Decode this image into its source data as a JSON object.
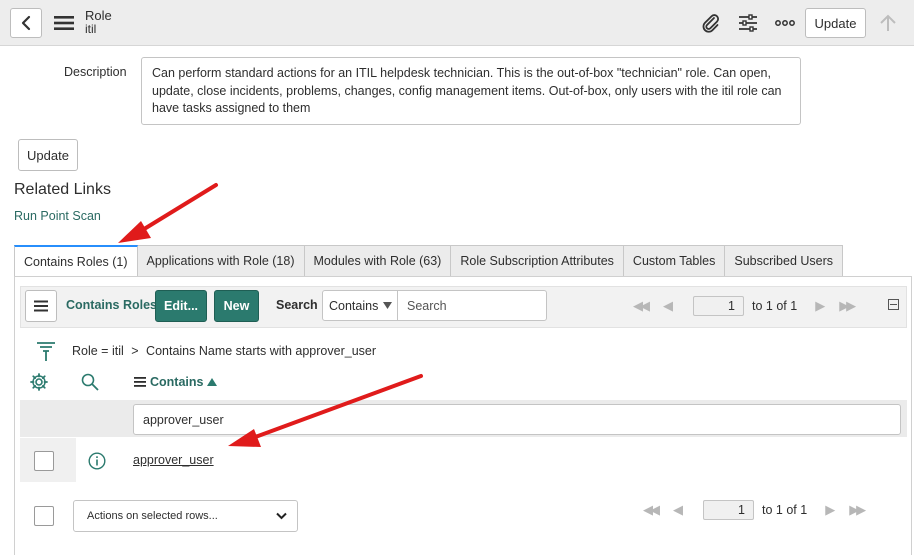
{
  "header": {
    "record_type": "Role",
    "record_name": "itil",
    "update_label": "Update",
    "icons": [
      "chevron-left-icon",
      "hamburger-icon",
      "paperclip-icon",
      "sliders-icon",
      "more-icon",
      "arrow-up-icon"
    ]
  },
  "form": {
    "description_label": "Description",
    "description": "Can perform standard actions for an ITIL helpdesk technician. This is the out-of-box \"technician\" role. Can open, update, close incidents, problems, changes, config management items. Out-of-box, only users with the itil role can have tasks assigned to them",
    "update_label": "Update"
  },
  "related_links": {
    "title": "Related Links",
    "run_point_scan": "Run Point Scan"
  },
  "tabs": [
    {
      "label": "Contains Roles (1)",
      "active": true
    },
    {
      "label": "Applications with Role (18)"
    },
    {
      "label": "Modules with Role (63)"
    },
    {
      "label": "Role Subscription Attributes"
    },
    {
      "label": "Custom Tables"
    },
    {
      "label": "Subscribed Users"
    }
  ],
  "list": {
    "title": "Contains Roles",
    "edit_label": "Edit...",
    "new_label": "New",
    "search_label": "Search",
    "search_field": "Contains",
    "search_placeholder": "Search",
    "page_value": "1",
    "page_total": "to 1 of 1",
    "breadcrumb_root": "Role = itil",
    "breadcrumb_sep": ">",
    "breadcrumb_filter": "Contains Name starts with approver_user",
    "column_header": "Contains",
    "column_filter_value": "approver_user",
    "rows": [
      {
        "contains": "approver_user"
      }
    ],
    "actions_label": "Actions on selected rows..."
  },
  "colors": {
    "accent_green": "#2b7a6e",
    "link_teal": "#2a6a62",
    "tab_active_border": "#278efc",
    "annotation_arrow": "#e01b1b"
  }
}
